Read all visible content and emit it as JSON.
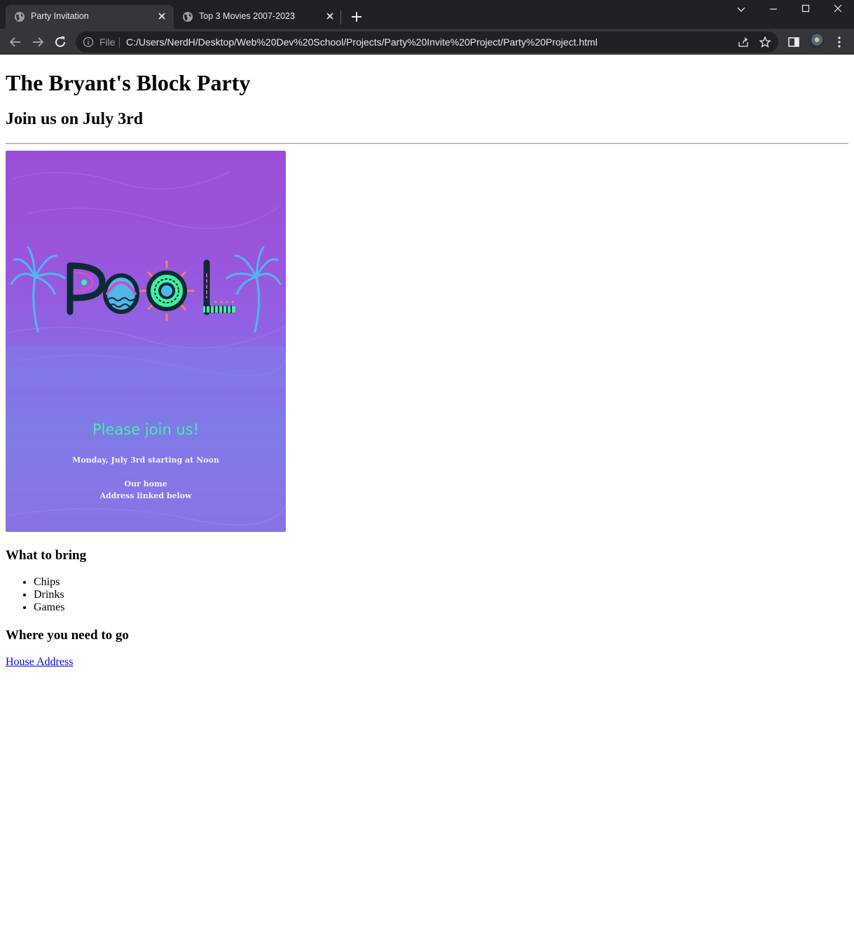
{
  "browser": {
    "tabs": [
      {
        "title": "Party Invitation",
        "active": true
      },
      {
        "title": "Top 3 Movies 2007-2023",
        "active": false
      }
    ],
    "scheme_label": "File",
    "url": "C:/Users/NerdH/Desktop/Web%20Dev%20School/Projects/Party%20Invite%20Project/Party%20Project.html",
    "colors": {
      "chrome": "#202124",
      "toolbar": "#35363a",
      "text": "#e8eaed"
    }
  },
  "page": {
    "title": "The Bryant's Block Party",
    "subtitle": "Join us on July 3rd",
    "poster": {
      "logo_text": "POOL",
      "headline": "Please join us!",
      "line1": "Monday, July 3rd starting at Noon",
      "line2": "Our home",
      "line3": "Address linked below",
      "colors": {
        "top": "#9b4fd6",
        "bottom": "#7f7be8",
        "headline": "#3ff0a2"
      }
    },
    "bring_heading": "What to bring",
    "bring_items": [
      "Chips",
      "Drinks",
      "Games"
    ],
    "where_heading": "Where you need to go",
    "address_link": "House Address",
    "link_color": "#0000ee"
  }
}
